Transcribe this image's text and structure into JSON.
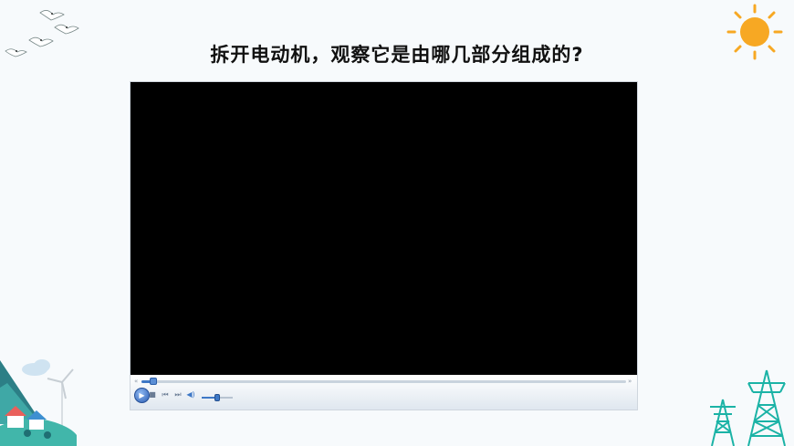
{
  "slide": {
    "title": "拆开电动机，观察它是由哪几部分组成的?"
  },
  "player": {
    "progress": 0.02,
    "volume": 0.5,
    "icons": [
      "play-icon",
      "stop-icon",
      "previous-icon",
      "next-icon",
      "volume-icon"
    ]
  },
  "colors": {
    "sun": "#f7a823",
    "tower": "#1bb3a6",
    "accent": "#3e78c6",
    "background": "#f7fafc"
  }
}
